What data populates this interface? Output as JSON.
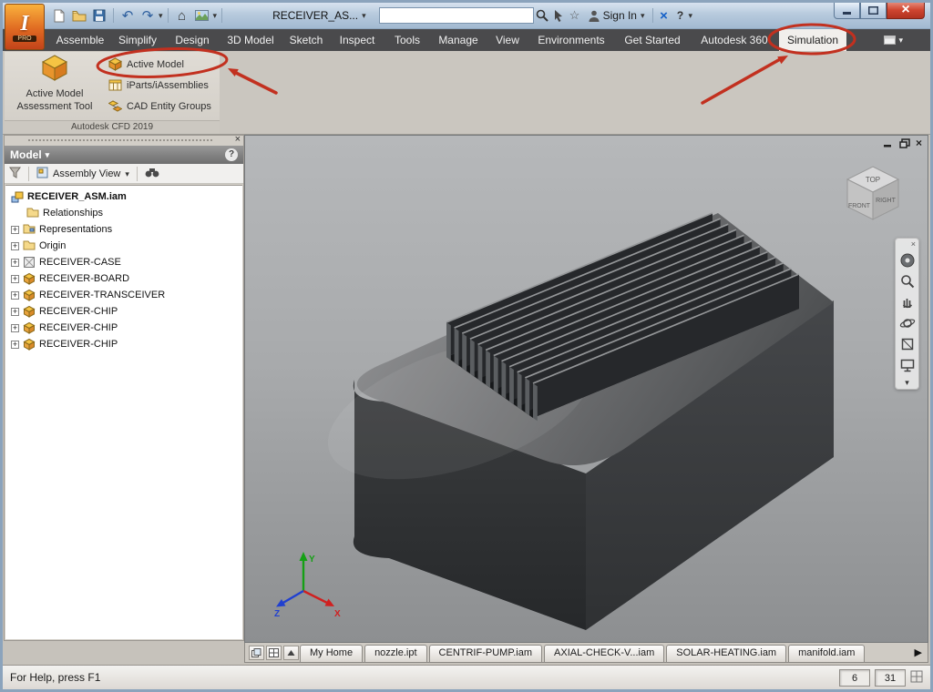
{
  "titlebar": {
    "app_logo": "I",
    "app_logo_sub": "PRO",
    "doc_name": "RECEIVER_AS...",
    "sign_in_label": "Sign In",
    "search_value": ""
  },
  "ribbon": {
    "tabs": [
      "Assemble",
      "Simplify",
      "Design",
      "3D Model",
      "Sketch",
      "Inspect",
      "Tools",
      "Manage",
      "View",
      "Environments",
      "Get Started",
      "Autodesk 360",
      "Simulation"
    ],
    "active_tab": "Simulation",
    "cfd_panel": {
      "big_button_line1": "Active Model",
      "big_button_line2": "Assessment Tool",
      "buttons": [
        "Active Model",
        "iParts/iAssemblies",
        "CAD Entity Groups"
      ],
      "footer": "Autodesk CFD 2019"
    }
  },
  "browser": {
    "title": "Model",
    "view_mode": "Assembly View",
    "tree": [
      {
        "label": "RECEIVER_ASM.iam",
        "icon": "assembly"
      },
      {
        "label": "Relationships",
        "icon": "folder"
      },
      {
        "label": "Representations",
        "icon": "folder"
      },
      {
        "label": "Origin",
        "icon": "folder"
      },
      {
        "label": "RECEIVER-CASE",
        "icon": "case-part"
      },
      {
        "label": "RECEIVER-BOARD",
        "icon": "part"
      },
      {
        "label": "RECEIVER-TRANSCEIVER",
        "icon": "part"
      },
      {
        "label": "RECEIVER-CHIP",
        "icon": "part"
      },
      {
        "label": "RECEIVER-CHIP",
        "icon": "part"
      },
      {
        "label": "RECEIVER-CHIP",
        "icon": "part"
      }
    ]
  },
  "viewport": {
    "viewcube": {
      "top": "TOP",
      "front": "FRONT",
      "right": "RIGHT"
    },
    "triad": {
      "x": "X",
      "y": "Y",
      "z": "Z"
    }
  },
  "doc_tabs": [
    {
      "label": "My Home"
    },
    {
      "label": "nozzle.ipt"
    },
    {
      "label": "CENTRIF-PUMP.iam"
    },
    {
      "label": "AXIAL-CHECK-V...iam"
    },
    {
      "label": "SOLAR-HEATING.iam"
    },
    {
      "label": "manifold.iam"
    }
  ],
  "statusbar": {
    "help_text": "For Help, press F1",
    "counter_a": "6",
    "counter_b": "31"
  },
  "colors": {
    "annotation_red": "#c2301f",
    "ribbon_dark": "#4a4a4c"
  }
}
